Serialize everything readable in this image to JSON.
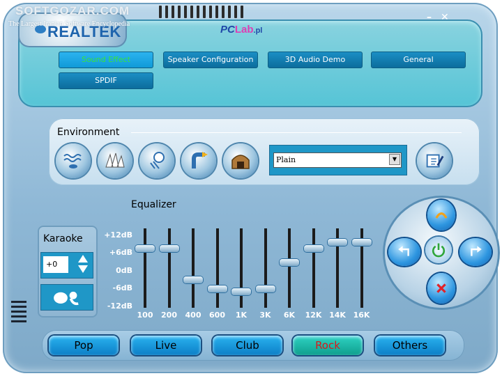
{
  "watermark": {
    "line1": "SOFTGOZAR.COM",
    "line2": "The Largest Iranian Software Encyclopedia"
  },
  "logo": {
    "text": "REALTEK",
    "partner": {
      "prefix": "PC",
      "suffix": "Lab",
      "tail": ".pl"
    }
  },
  "window": {
    "minimize": "–",
    "close": "✕"
  },
  "tabs": [
    {
      "label": "Sound Effect",
      "active": true
    },
    {
      "label": "Speaker Configuration",
      "active": false
    },
    {
      "label": "3D Audio Demo",
      "active": false
    },
    {
      "label": "General",
      "active": false
    },
    {
      "label": "SPDIF",
      "active": false
    }
  ],
  "environment": {
    "title": "Environment",
    "selected": "Plain",
    "icons": [
      "underwater-icon",
      "opera-house-icon",
      "sewer-icon",
      "pipe-icon",
      "stone-room-icon"
    ]
  },
  "equalizer": {
    "title": "Equalizer",
    "db_labels": [
      "+12dB",
      "+6dB",
      "0dB",
      "-6dB",
      "-12dB"
    ],
    "bands": [
      {
        "freq": "100",
        "db": 9
      },
      {
        "freq": "200",
        "db": 9
      },
      {
        "freq": "400",
        "db": -2
      },
      {
        "freq": "600",
        "db": -5
      },
      {
        "freq": "1K",
        "db": -6
      },
      {
        "freq": "3K",
        "db": -5
      },
      {
        "freq": "6K",
        "db": 4
      },
      {
        "freq": "12K",
        "db": 9
      },
      {
        "freq": "14K",
        "db": 11
      },
      {
        "freq": "16K",
        "db": 11
      }
    ]
  },
  "karaoke": {
    "label": "Karaoke",
    "value": "+0"
  },
  "presets": [
    {
      "label": "Pop",
      "active": false
    },
    {
      "label": "Live",
      "active": false
    },
    {
      "label": "Club",
      "active": false
    },
    {
      "label": "Rock",
      "active": true
    },
    {
      "label": "Others",
      "active": false
    }
  ],
  "colors": {
    "active_tab_text": "#39e33d",
    "active_preset_text": "#d81a1a",
    "power_ring": "#2fa63a"
  }
}
